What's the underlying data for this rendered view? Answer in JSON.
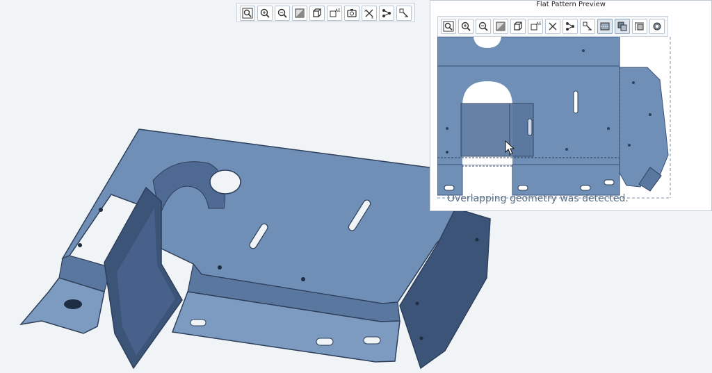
{
  "preview": {
    "title": "Flat Pattern Preview",
    "warning": "Overlapping geometry was detected."
  },
  "main_toolbar": {
    "buttons": [
      "zoom-window-icon",
      "zoom-in-icon",
      "zoom-out-icon",
      "shade-icon",
      "view-cube-icon",
      "saved-views-icon",
      "camera-icon",
      "datum-display-icon",
      "network-icon",
      "analysis-icon"
    ]
  },
  "preview_toolbar": {
    "buttons": [
      "zoom-window-icon",
      "zoom-in-icon",
      "zoom-out-icon",
      "shade-icon",
      "view-cube-icon",
      "saved-views-icon",
      "datum-display-icon",
      "network-icon",
      "analysis-icon",
      "bend-lines-icon",
      "overlap-icon",
      "dimension-icon",
      "settings-icon"
    ]
  },
  "colors": {
    "part_face": "#6f8fb6",
    "part_dark": "#4a648a",
    "part_edge": "#2d3f5a",
    "background": "#f1f4f7"
  }
}
